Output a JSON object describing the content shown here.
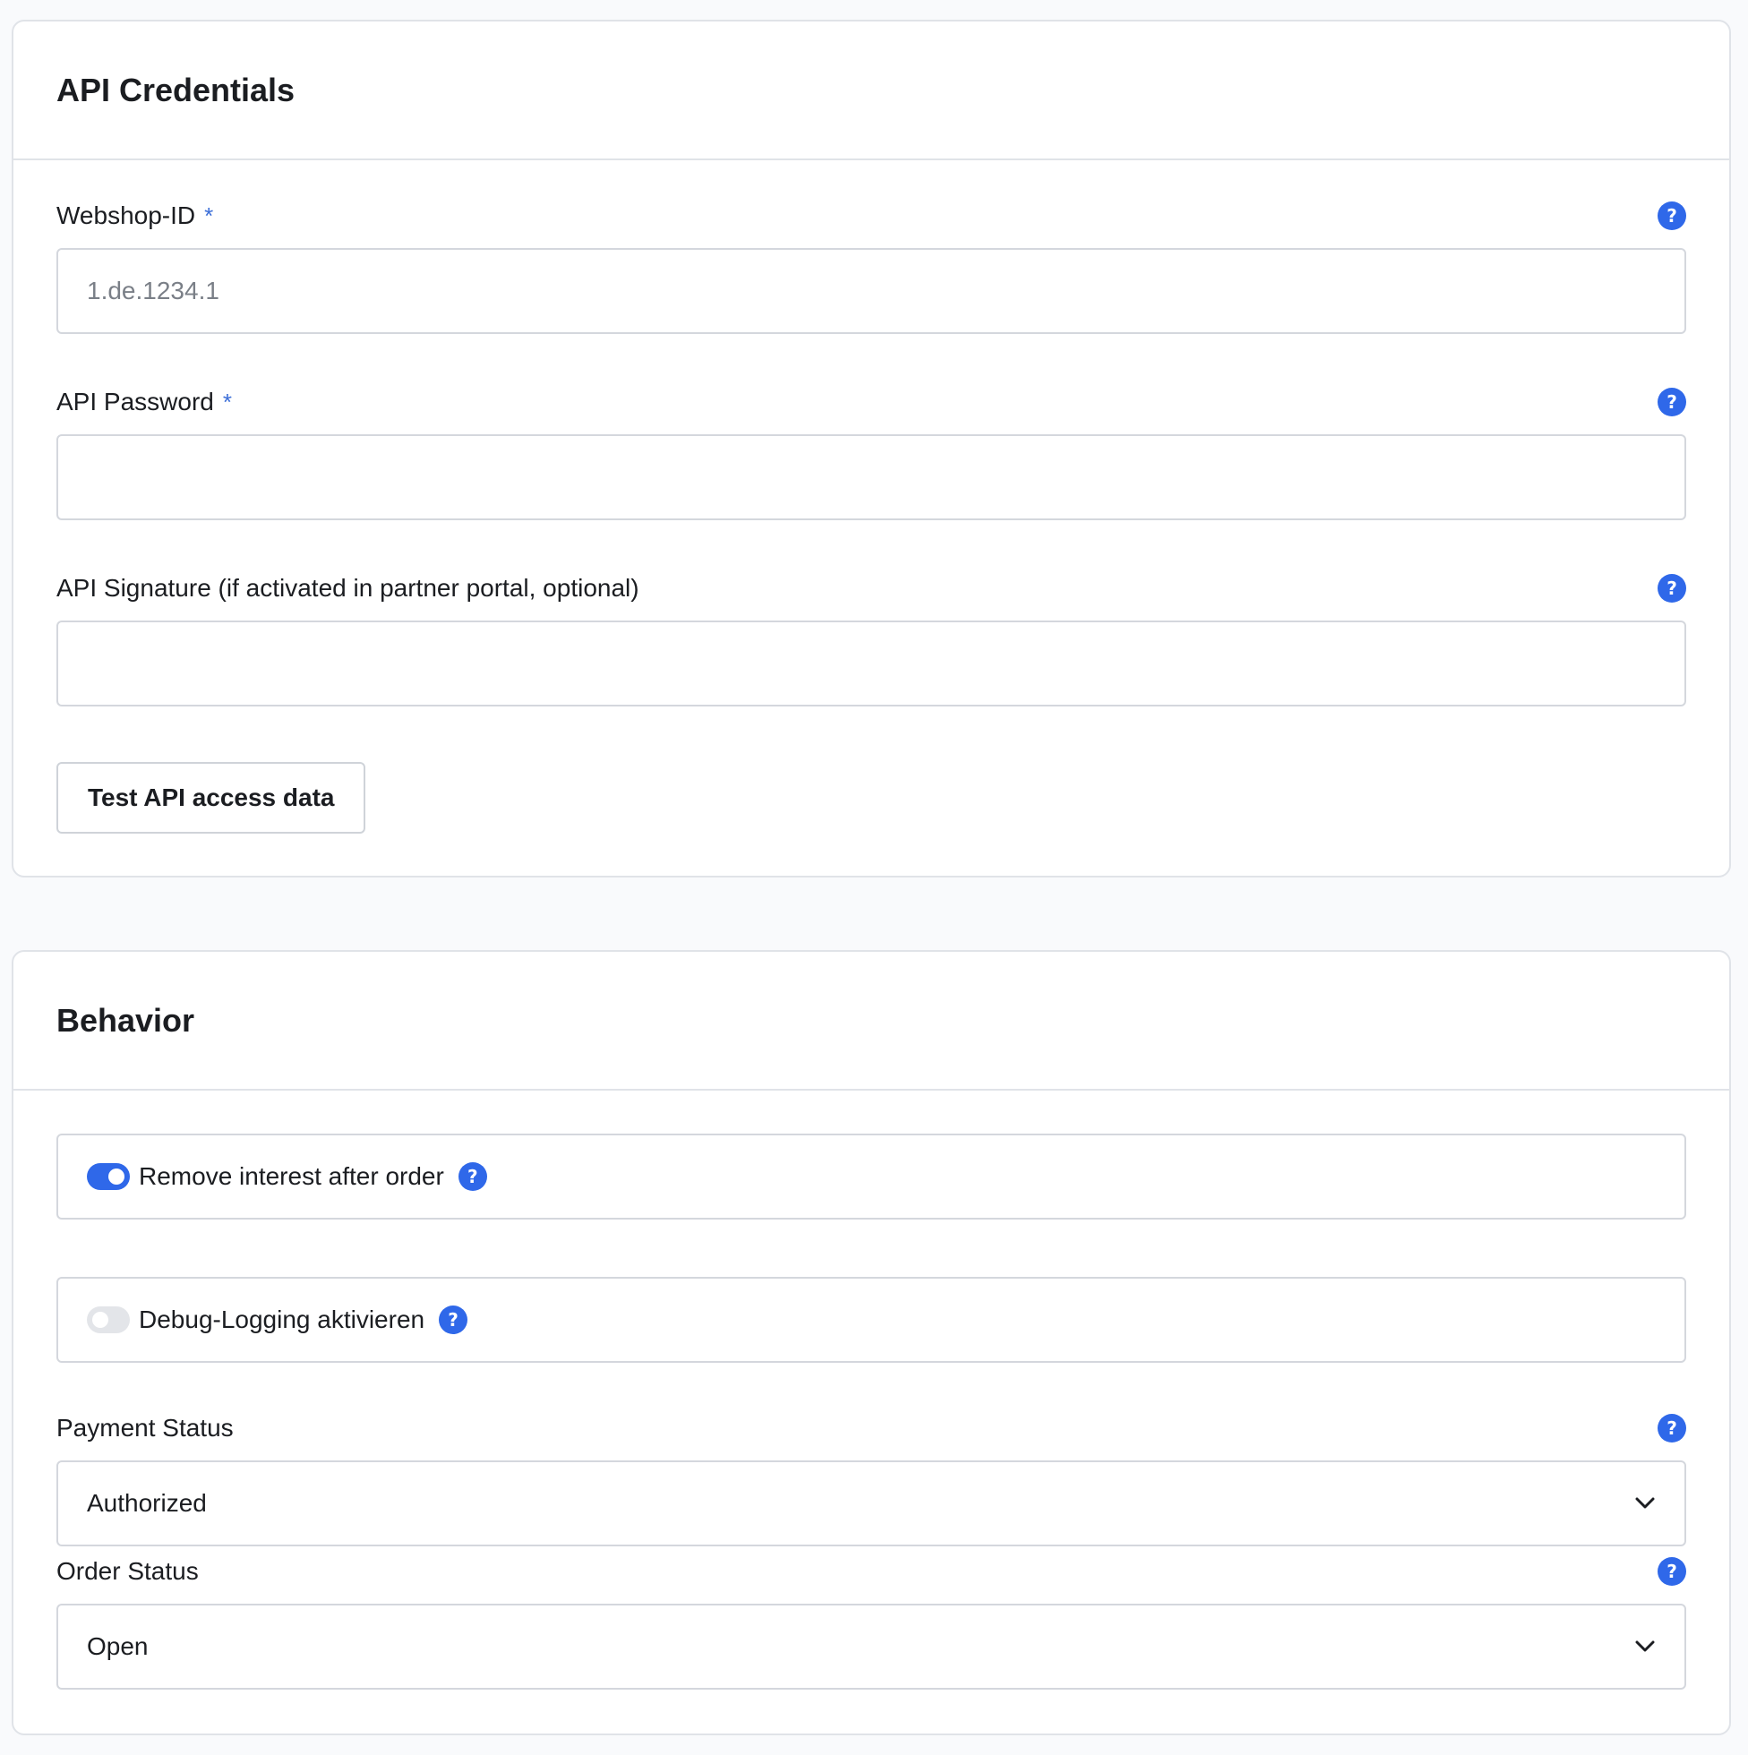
{
  "api_credentials": {
    "title": "API Credentials",
    "webshop_id": {
      "label": "Webshop-ID",
      "required_mark": "*",
      "placeholder": "1.de.1234.1",
      "value": ""
    },
    "api_password": {
      "label": "API Password",
      "required_mark": "*",
      "value": ""
    },
    "api_signature": {
      "label": "API Signature (if activated in partner portal, optional)",
      "value": ""
    },
    "test_button_label": "Test API access data"
  },
  "behavior": {
    "title": "Behavior",
    "remove_interest": {
      "label": "Remove interest after order",
      "enabled": true
    },
    "debug_logging": {
      "label": "Debug-Logging aktivieren",
      "enabled": false
    },
    "payment_status": {
      "label": "Payment Status",
      "selected": "Authorized"
    },
    "order_status": {
      "label": "Order Status",
      "selected": "Open"
    }
  },
  "help_icon_glyph": "?",
  "colors": {
    "accent": "#2f68e9",
    "border": "#d4d7dd",
    "background": "#f9fafc"
  }
}
